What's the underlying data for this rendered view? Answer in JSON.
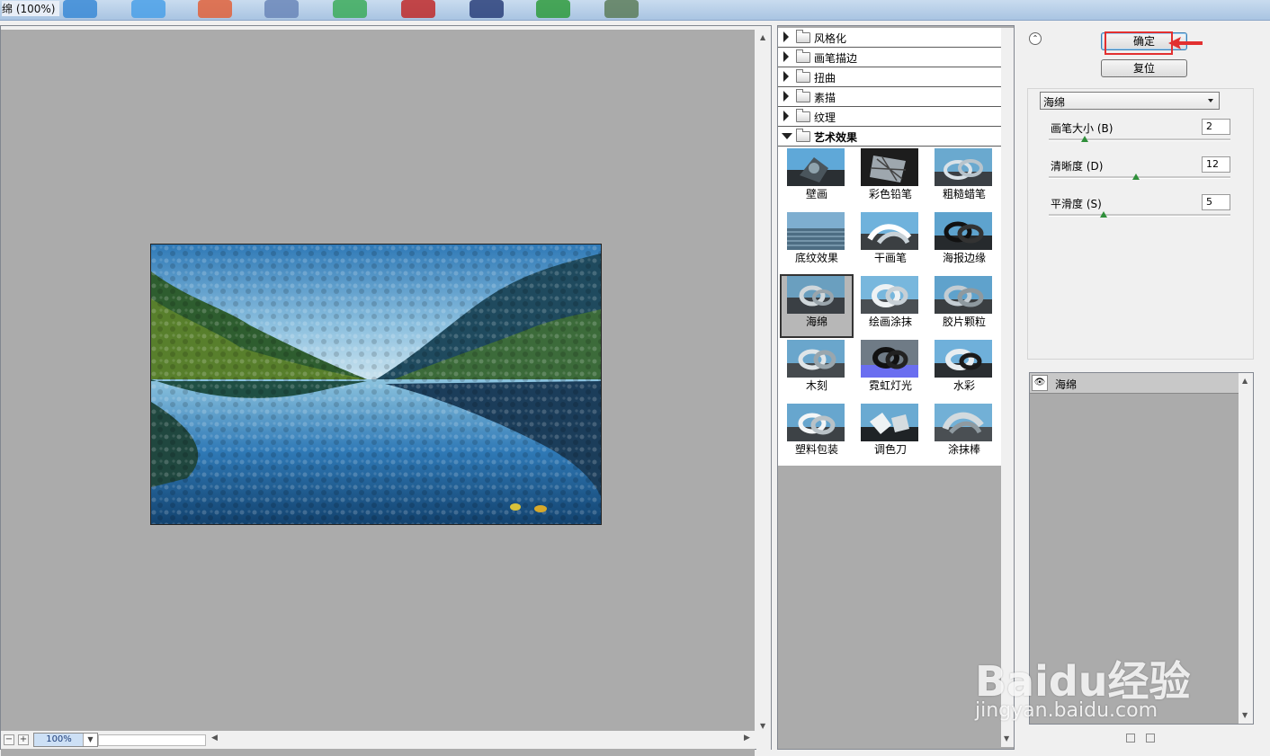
{
  "window": {
    "title": "绵 (100%)"
  },
  "preview": {
    "zoom": "100%"
  },
  "filter_categories": [
    {
      "label": "风格化",
      "expanded": false
    },
    {
      "label": "画笔描边",
      "expanded": false
    },
    {
      "label": "扭曲",
      "expanded": false
    },
    {
      "label": "素描",
      "expanded": false
    },
    {
      "label": "纹理",
      "expanded": false
    },
    {
      "label": "艺术效果",
      "expanded": true
    }
  ],
  "thumbnails": [
    {
      "label": "壁画"
    },
    {
      "label": "彩色铅笔"
    },
    {
      "label": "粗糙蜡笔"
    },
    {
      "label": "底纹效果"
    },
    {
      "label": "干画笔"
    },
    {
      "label": "海报边缘"
    },
    {
      "label": "海绵",
      "selected": true
    },
    {
      "label": "绘画涂抹"
    },
    {
      "label": "胶片颗粒"
    },
    {
      "label": "木刻"
    },
    {
      "label": "霓虹灯光"
    },
    {
      "label": "水彩"
    },
    {
      "label": "塑料包装"
    },
    {
      "label": "调色刀"
    },
    {
      "label": "涂抹棒"
    }
  ],
  "buttons": {
    "ok": "确定",
    "reset": "复位"
  },
  "filter_select": {
    "value": "海绵"
  },
  "params": [
    {
      "label": "画笔大小 (B)",
      "value": "2",
      "fraction": 0.2
    },
    {
      "label": "清晰度 (D)",
      "value": "12",
      "fraction": 0.48
    },
    {
      "label": "平滑度 (S)",
      "value": "5",
      "fraction": 0.3
    }
  ],
  "layers": [
    {
      "name": "海绵",
      "visible": true
    }
  ],
  "watermark": {
    "brand": "Baidu经验",
    "url": "jingyan.baidu.com"
  },
  "colors": {
    "highlight_box": "#e23030",
    "slider_knob": "#2f8f3a",
    "gray_bg": "#ababab"
  }
}
